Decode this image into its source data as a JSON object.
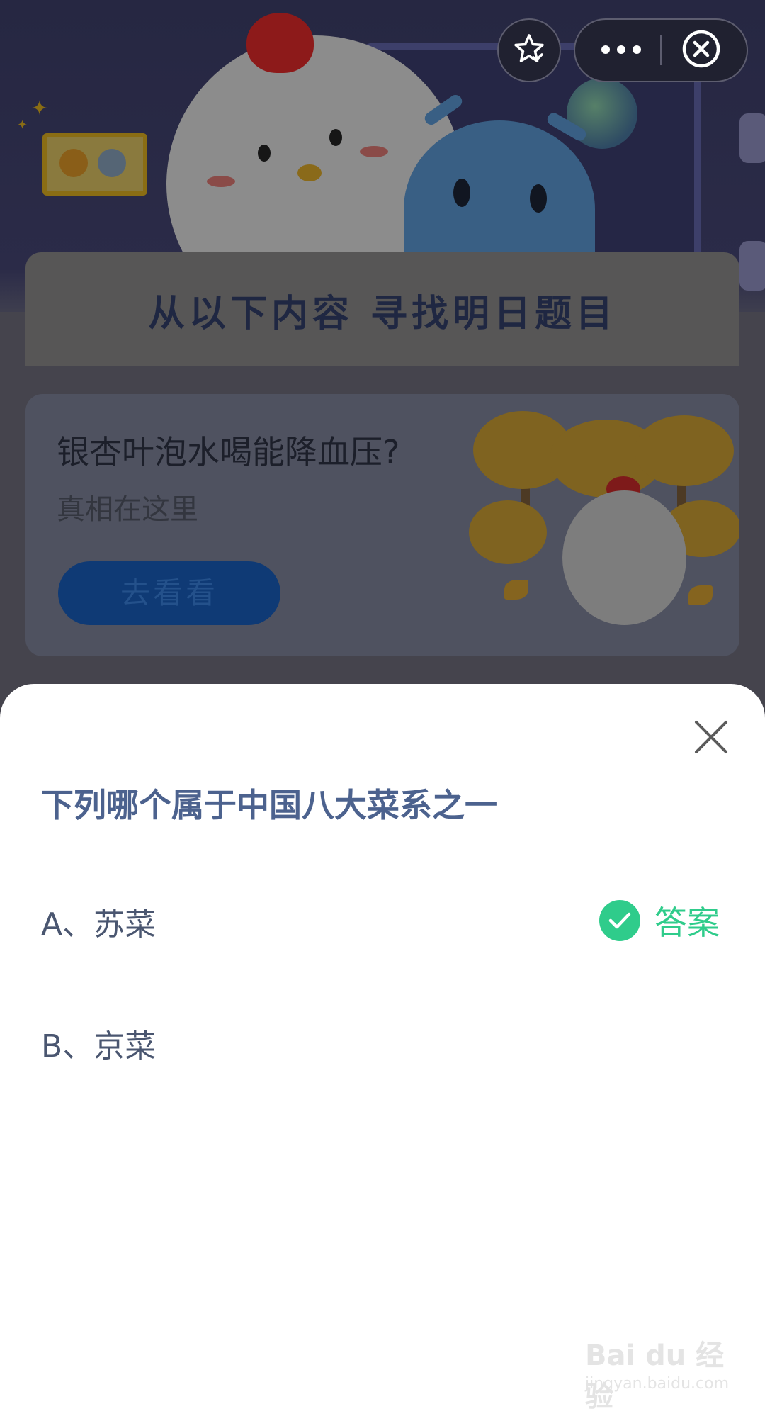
{
  "top_bar": {
    "favorite_icon": "star-check-icon",
    "more_icon": "more-dots-icon",
    "close_icon": "close-circle-icon"
  },
  "section": {
    "title": "从以下内容  寻找明日题目"
  },
  "promo": {
    "title": "银杏叶泡水喝能降血压?",
    "subtitle": "真相在这里",
    "button_label": "去看看"
  },
  "quiz": {
    "question": "下列哪个属于中国八大菜系之一",
    "options": [
      {
        "label": "A、苏菜",
        "is_answer": true
      },
      {
        "label": "B、京菜",
        "is_answer": false
      }
    ],
    "answer_label": "答案",
    "answer_color": "#2fcc8b",
    "close_icon": "close-x-icon"
  },
  "watermark": {
    "brand": "Bai du 经验",
    "url": "jingyan.baidu.com"
  }
}
